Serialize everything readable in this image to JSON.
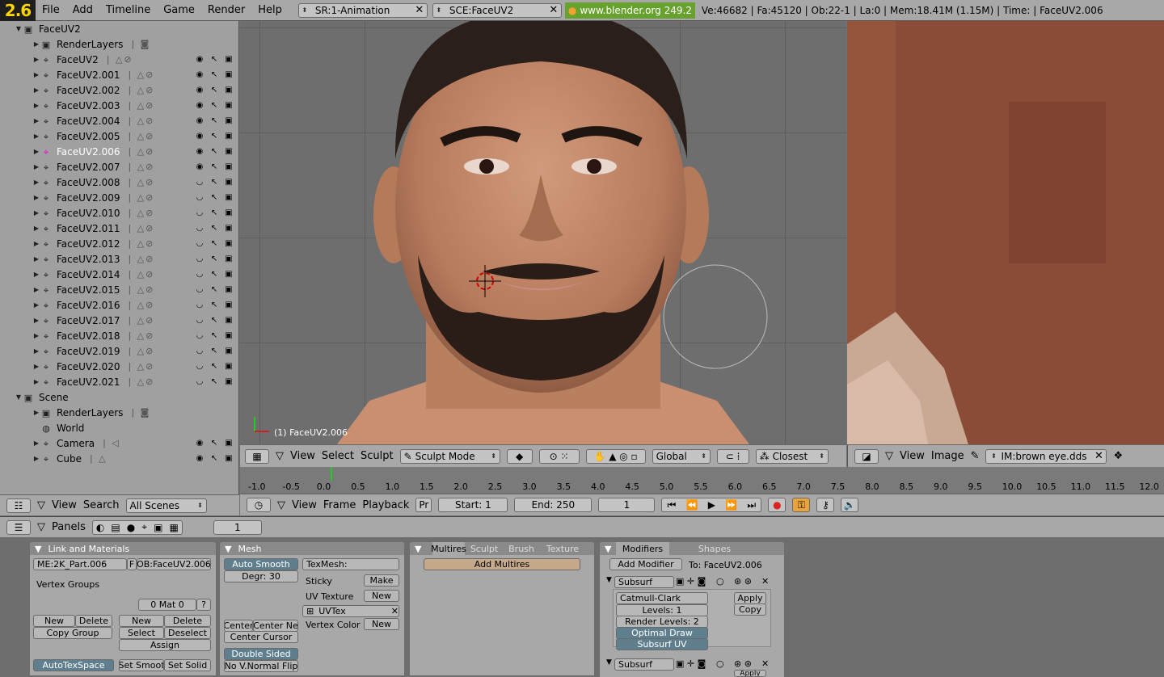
{
  "topbar": {
    "logo": "2.6",
    "menus": [
      "File",
      "Add",
      "Timeline",
      "Game",
      "Render",
      "Help"
    ],
    "screen": "SR:1-Animation",
    "scene": "SCE:FaceUV2",
    "url": "www.blender.org 249.2",
    "stats": "Ve:46682 | Fa:45120 | Ob:22-1 | La:0  | Mem:18.41M (1.15M)  | Time: | FaceUV2.006"
  },
  "outliner": {
    "scene1": "FaceUV2",
    "renderlayers": "RenderLayers",
    "objects": [
      "FaceUV2",
      "FaceUV2.001",
      "FaceUV2.002",
      "FaceUV2.003",
      "FaceUV2.004",
      "FaceUV2.005",
      "FaceUV2.006",
      "FaceUV2.007",
      "FaceUV2.008",
      "FaceUV2.009",
      "FaceUV2.010",
      "FaceUV2.011",
      "FaceUV2.012",
      "FaceUV2.013",
      "FaceUV2.014",
      "FaceUV2.015",
      "FaceUV2.016",
      "FaceUV2.017",
      "FaceUV2.018",
      "FaceUV2.019",
      "FaceUV2.020",
      "FaceUV2.021"
    ],
    "scene2": "Scene",
    "renderlayers2": "RenderLayers",
    "world": "World",
    "camera": "Camera",
    "cube": "Cube",
    "bar": {
      "view": "View",
      "search": "Search",
      "filter": "All Scenes"
    }
  },
  "viewport": {
    "label": "(1) FaceUV2.006",
    "bar": {
      "view": "View",
      "select": "Select",
      "sculpt": "Sculpt",
      "mode": "Sculpt Mode",
      "orient": "Global",
      "snap": "Closest"
    }
  },
  "imageeditor": {
    "bar": {
      "view": "View",
      "image": "Image",
      "imagename": "IM:brown eye.dds"
    }
  },
  "timeline": {
    "ticks": [
      "-1.0",
      "-0.5",
      "0.0",
      "0.5",
      "1.0",
      "1.5",
      "2.0",
      "2.5",
      "3.0",
      "3.5",
      "4.0",
      "4.5",
      "5.0",
      "5.5",
      "6.0",
      "6.5",
      "7.0",
      "7.5",
      "8.0",
      "8.5",
      "9.0",
      "9.5",
      "10.0",
      "10.5",
      "11.0",
      "11.5",
      "12.0"
    ],
    "bar": {
      "view": "View",
      "frame": "Frame",
      "playback": "Playback",
      "pr": "Pr",
      "start": "Start: 1",
      "end": "End: 250",
      "current": "1"
    }
  },
  "buttons": {
    "header": {
      "panels": "Panels",
      "frame": "1"
    },
    "link": {
      "title": "Link and Materials",
      "me": "ME:2K_Part.006",
      "f": "F",
      "ob": "OB:FaceUV2.006",
      "vgroups": "Vertex Groups",
      "mat": "0 Mat 0",
      "q": "?",
      "new1": "New",
      "delete1": "Delete",
      "copygroup": "Copy Group",
      "new2": "New",
      "delete2": "Delete",
      "select": "Select",
      "deselect": "Deselect",
      "assign": "Assign",
      "autotex": "AutoTexSpace",
      "setsmooth": "Set Smoot",
      "setsolid": "Set Solid"
    },
    "mesh": {
      "title": "Mesh",
      "autosmooth": "Auto Smooth",
      "degr": "Degr: 30",
      "texmesh": "TexMesh:",
      "sticky": "Sticky",
      "make": "Make",
      "uvtexture": "UV Texture",
      "new": "New",
      "uvtex": "UVTex",
      "vcol": "Vertex Color",
      "new2": "New",
      "center": "Center",
      "centerne": "Center Ne",
      "centercursor": "Center Cursor",
      "doublesided": "Double Sided",
      "nonormal": "No V.Normal Flip"
    },
    "multires": {
      "tabs": [
        "Multires",
        "Sculpt",
        "Brush",
        "Texture"
      ],
      "add": "Add Multires"
    },
    "modifiers": {
      "tabs": [
        "Modifiers",
        "Shapes"
      ],
      "add": "Add Modifier",
      "to": "To: FaceUV2.006",
      "subsurf": "Subsurf",
      "catmull": "Catmull-Clark",
      "levels": "Levels: 1",
      "render": "Render Levels: 2",
      "optimal": "Optimal Draw",
      "subsurfuv": "Subsurf UV",
      "apply": "Apply",
      "copy": "Copy",
      "subsurf2": "Subsurf",
      "apply2": "Apply"
    }
  }
}
